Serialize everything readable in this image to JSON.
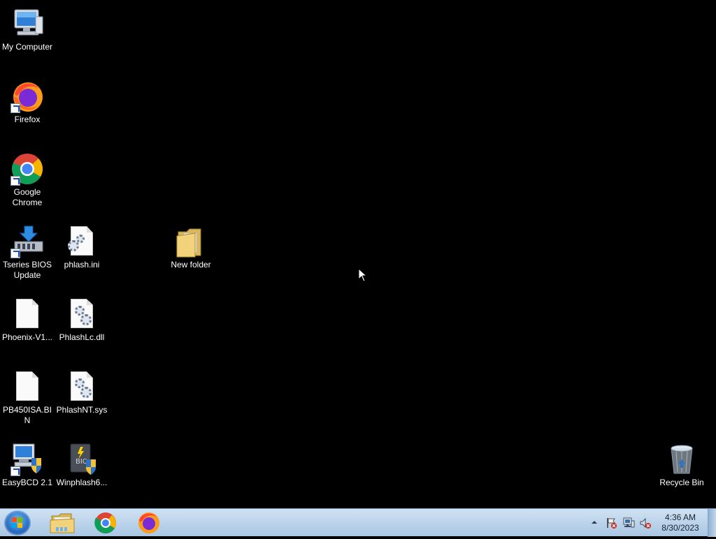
{
  "desktop": {
    "icons": [
      {
        "label": "My Computer"
      },
      {
        "label": "Firefox"
      },
      {
        "label": "Google Chrome"
      },
      {
        "label": "Tseries BIOS Update"
      },
      {
        "label": "phlash.ini"
      },
      {
        "label": "New folder"
      },
      {
        "label": "Phoenix-V1..."
      },
      {
        "label": "PhlashLc.dll"
      },
      {
        "label": "PB450ISA.BIN"
      },
      {
        "label": "PhlashNT.sys"
      },
      {
        "label": "EasyBCD 2.1"
      },
      {
        "label": "Winphlash6..."
      },
      {
        "label": "Recycle Bin"
      }
    ]
  },
  "taskbar": {
    "pinned": [
      "windows-explorer-icon",
      "chrome-icon",
      "firefox-icon"
    ],
    "tray_icons": [
      "show-hidden-icons",
      "action-center-flag-icon",
      "network-icon",
      "volume-muted-icon"
    ],
    "clock": {
      "time": "4:36 AM",
      "date": "8/30/2023"
    }
  }
}
